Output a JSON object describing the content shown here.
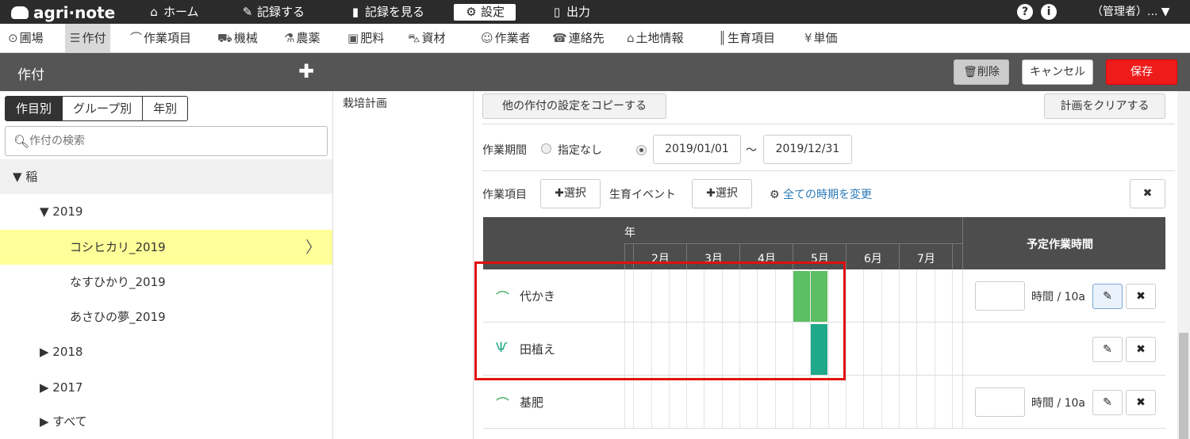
{
  "topbar": {
    "logo": "agri·note",
    "nav": [
      {
        "icon": "home-icon",
        "glyph": "⌂",
        "label": "ホーム"
      },
      {
        "icon": "pencil-icon",
        "glyph": "✎",
        "label": "記録する"
      },
      {
        "icon": "book-icon",
        "glyph": "▮",
        "label": "記録を見る"
      },
      {
        "icon": "gear-icon",
        "glyph": "⚙",
        "label": "設定"
      },
      {
        "icon": "document-icon",
        "glyph": "▯",
        "label": "出力"
      }
    ],
    "help": "?",
    "info": "i",
    "admin": "（管理者）... ▼"
  },
  "subnav": [
    {
      "icon": "map-pin-icon",
      "glyph": "⊙",
      "label": "圃場"
    },
    {
      "icon": "list-icon",
      "glyph": "☰",
      "label": "作付"
    },
    {
      "icon": "sickle-icon",
      "glyph": "⌒",
      "label": "作業項目"
    },
    {
      "icon": "tractor-icon",
      "glyph": "⛟",
      "label": "機械"
    },
    {
      "icon": "flask-icon",
      "glyph": "⚗",
      "label": "農薬"
    },
    {
      "icon": "fertilizer-bag-icon",
      "glyph": "▣",
      "label": "肥料"
    },
    {
      "icon": "wheelbarrow-icon",
      "glyph": "⛍",
      "label": "資材"
    },
    {
      "icon": "worker-icon",
      "glyph": "☺",
      "label": "作業者"
    },
    {
      "icon": "phone-book-icon",
      "glyph": "☎",
      "label": "連絡先"
    },
    {
      "icon": "land-icon",
      "glyph": "⌂",
      "label": "土地情報"
    },
    {
      "icon": "growth-icon",
      "glyph": "║",
      "label": "生育項目"
    },
    {
      "icon": "yen-icon",
      "glyph": "¥",
      "label": "単価"
    }
  ],
  "header": {
    "title": "作付",
    "add": "✚",
    "delete_icon": "trash-icon",
    "delete": "削除",
    "cancel": "キャンセル",
    "save": "保存"
  },
  "left": {
    "tabs": [
      "作目別",
      "グループ別",
      "年別"
    ],
    "search_placeholder": "作付の検索",
    "tree": [
      {
        "label": "▼ 稲"
      },
      {
        "label": "▼ 2019"
      },
      {
        "label": "コシヒカリ_2019"
      },
      {
        "label": "なすひかり_2019"
      },
      {
        "label": "あさひの夢_2019"
      },
      {
        "label": "▶ 2018"
      },
      {
        "label": "▶ 2017"
      },
      {
        "label": "▶ すべて"
      }
    ]
  },
  "main": {
    "section_label": "栽培計画",
    "copy_button": "他の作付の設定をコピーする",
    "clear_button": "計画をクリアする",
    "period_label": "作業期間",
    "no_period": "指定なし",
    "start_date": "2019/01/01",
    "tilde": "～",
    "end_date": "2019/12/31",
    "task_label": "作業項目",
    "select": "✚選択",
    "growth_event_label": "生育イベント",
    "change_all": "全ての時期を変更",
    "gantt": {
      "year": "年",
      "months": [
        "2月",
        "3月",
        "4月",
        "5月",
        "6月",
        "7月"
      ],
      "planned_hours": "予定作業時間",
      "unit": "時間 / 10a",
      "rows": [
        {
          "name": "代かき",
          "icon": "sickle-icon",
          "bar_color": "#5cbf63"
        },
        {
          "name": "田植え",
          "icon": "rice-plant-icon",
          "bar_color": "#1fa88a"
        },
        {
          "name": "基肥",
          "icon": "sickle-icon",
          "bar_color": ""
        }
      ]
    }
  }
}
